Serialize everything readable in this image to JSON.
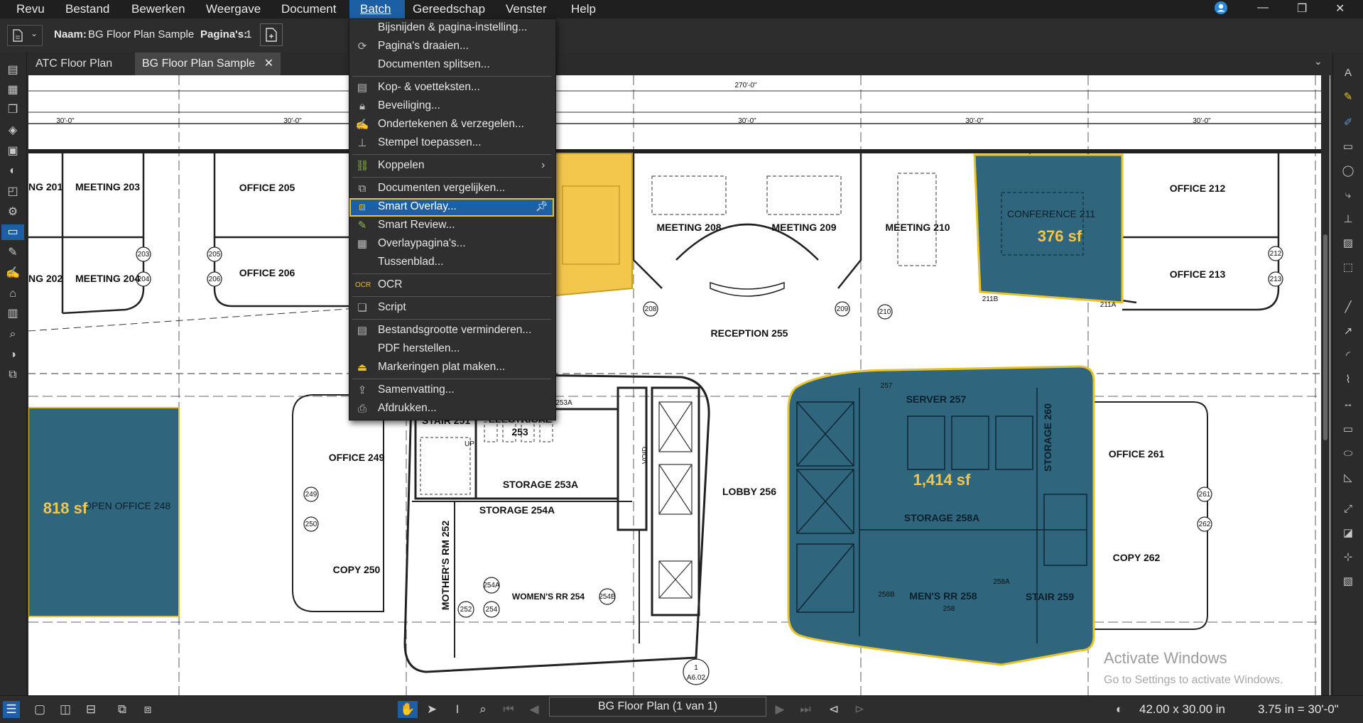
{
  "menubar": {
    "items": [
      "Revu",
      "Bestand",
      "Bewerken",
      "Weergave",
      "Document",
      "Batch",
      "Gereedschap",
      "Venster",
      "Help"
    ]
  },
  "toolbar": {
    "name_label": "Naam:",
    "name_value": "BG Floor Plan Sample",
    "pages_label": "Pagina's:",
    "pages_value": "1"
  },
  "tabs": [
    "ATC Floor Plan",
    "BG Floor Plan Sample"
  ],
  "batch_menu": {
    "items": [
      {
        "label": "Bijsnijden & pagina-instelling...",
        "icon": "crop-icon"
      },
      {
        "label": "Pagina's draaien...",
        "icon": "rotate-pages-icon"
      },
      {
        "label": "Documenten splitsen...",
        "icon": "split-icon"
      },
      {
        "label": "Kop- & voetteksten...",
        "icon": "header-footer-icon"
      },
      {
        "label": "Beveiliging...",
        "icon": "lock-icon"
      },
      {
        "label": "Ondertekenen & verzegelen...",
        "icon": "signature-icon"
      },
      {
        "label": "Stempel toepassen...",
        "icon": "stamp-icon"
      },
      {
        "label": "Koppelen",
        "icon": "link-icon"
      },
      {
        "label": "Documenten vergelijken...",
        "icon": "compare-icon"
      },
      {
        "label": "Smart Overlay...",
        "icon": "smart-overlay-icon"
      },
      {
        "label": "Smart Review...",
        "icon": "smart-review-icon"
      },
      {
        "label": "Overlaypagina's...",
        "icon": "overlay-pages-icon"
      },
      {
        "label": "Tussenblad...",
        "icon": "slip-sheet-icon"
      },
      {
        "label": "OCR",
        "icon": "ocr-icon"
      },
      {
        "label": "Script",
        "icon": "script-icon"
      },
      {
        "label": "Bestandsgrootte verminderen...",
        "icon": "reduce-size-icon"
      },
      {
        "label": "PDF herstellen...",
        "icon": "repair-icon"
      },
      {
        "label": "Markeringen plat maken...",
        "icon": "flatten-icon"
      },
      {
        "label": "Samenvatting...",
        "icon": "summary-icon"
      },
      {
        "label": "Afdrukken...",
        "icon": "print-icon"
      }
    ]
  },
  "floorplan": {
    "dims": {
      "total": "270'-0\"",
      "bay": "30'-0\""
    },
    "rooms": [
      "NG 201",
      "MEETING 203",
      "OFFICE 205",
      "NG 202",
      "MEETING 204",
      "OFFICE 206",
      "MEETING 208",
      "MEETING 209",
      "MEETING 210",
      "CONFERENCE 211",
      "OFFICE 212",
      "OFFICE 213",
      "RECEPTION 255",
      "OPEN OFFICE 248",
      "STAIR 251",
      "ELECTRICAL",
      "253",
      "OFFICE 249",
      "STORAGE 253A",
      "STORAGE 254A",
      "COPY 250",
      "MOTHER'S RM 252",
      "WOMEN'S RR 254",
      "LOBBY 256",
      "SERVER 257",
      "STORAGE 260",
      "STORAGE 258A",
      "MEN'S RR 258",
      "STAIR 259",
      "OFFICE 261",
      "COPY 262",
      "VOID",
      "UP"
    ],
    "tags": [
      "203",
      "204",
      "205",
      "206",
      "208",
      "209",
      "210",
      "212",
      "213",
      "249",
      "250",
      "261",
      "262",
      "253A",
      "254A",
      "254B",
      "252",
      "254",
      "257",
      "258",
      "258A",
      "258B",
      "211A",
      "211B",
      "1",
      "A6.02"
    ],
    "area_labels": [
      "376 sf",
      "1,414 sf",
      "818 sf"
    ]
  },
  "watermark": {
    "title": "Activate Windows",
    "subtitle": "Go to Settings to activate Windows."
  },
  "status": {
    "page_selector": "BG Floor Plan (1 van 1)",
    "page_size": "42.00 x 30.00 in",
    "scale": "3.75 in = 30'-0\""
  },
  "colors": {
    "accent": "#1d5fa5",
    "highlight": "#e8c22a",
    "area_fill": "#2f667e",
    "yellow_fill": "#f3c64c"
  }
}
